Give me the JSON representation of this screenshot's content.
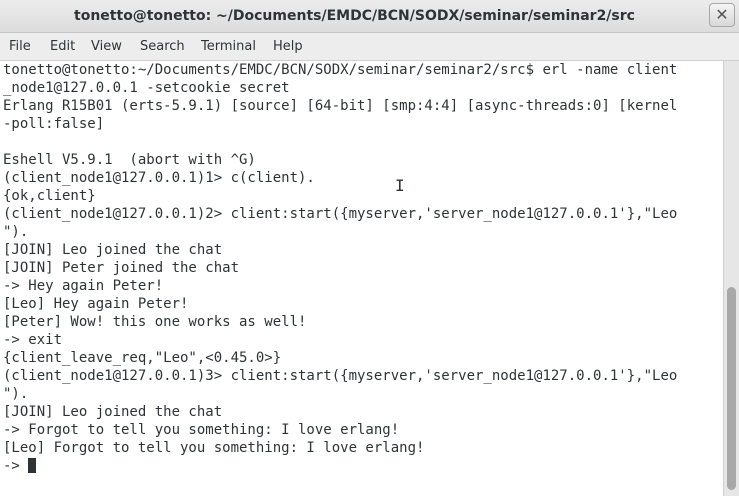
{
  "window": {
    "title": "tonetto@tonetto: ~/Documents/EMDC/BCN/SODX/seminar/seminar2/src",
    "close_glyph": "✕"
  },
  "menu": {
    "items": [
      "File",
      "Edit",
      "View",
      "Search",
      "Terminal",
      "Help"
    ]
  },
  "terminal": {
    "lines": [
      "tonetto@tonetto:~/Documents/EMDC/BCN/SODX/seminar/seminar2/src$ erl -name client",
      "_node1@127.0.0.1 -setcookie secret",
      "Erlang R15B01 (erts-5.9.1) [source] [64-bit] [smp:4:4] [async-threads:0] [kernel",
      "-poll:false]",
      "",
      "Eshell V5.9.1  (abort with ^G)",
      "(client_node1@127.0.0.1)1> c(client).",
      "{ok,client}",
      "(client_node1@127.0.0.1)2> client:start({myserver,'server_node1@127.0.0.1'},\"Leo",
      "\").",
      "[JOIN] Leo joined the chat",
      "[JOIN] Peter joined the chat",
      "-> Hey again Peter!",
      "[Leo] Hey again Peter!",
      "[Peter] Wow! this one works as well!",
      "-> exit",
      "{client_leave_req,\"Leo\",<0.45.0>}",
      "(client_node1@127.0.0.1)3> client:start({myserver,'server_node1@127.0.0.1'},\"Leo",
      "\").",
      "[JOIN] Leo joined the chat",
      "-> Forgot to tell you something: I love erlang!",
      "[Leo] Forgot to tell you something: I love erlang!"
    ],
    "prompt": "-> ",
    "mouse_cursor_glyph": "I"
  },
  "colors": {
    "text": "#2e3436",
    "background": "#ffffff",
    "chrome": "#ededed"
  }
}
